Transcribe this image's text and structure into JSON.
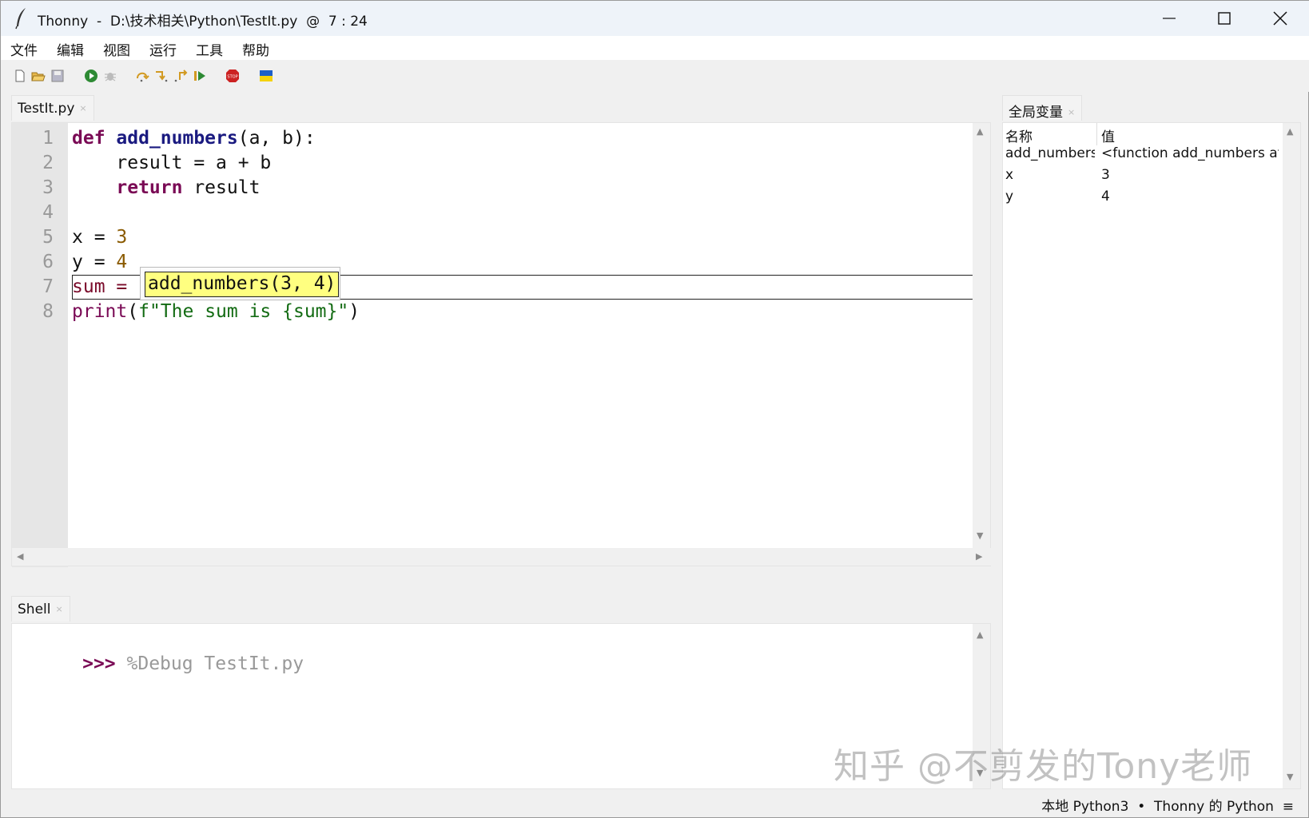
{
  "window": {
    "title": "Thonny  -  D:\\技术相关\\Python\\TestIt.py  @  7 : 24"
  },
  "menu": [
    "文件",
    "编辑",
    "视图",
    "运行",
    "工具",
    "帮助"
  ],
  "toolbar": {
    "icons": [
      "new-file-icon",
      "open-file-icon",
      "save-icon",
      "run-icon",
      "debug-icon",
      "step-over-icon",
      "step-into-icon",
      "step-out-icon",
      "resume-icon",
      "stop-icon",
      "ukraine-flag-icon"
    ]
  },
  "editor": {
    "tab_label": "TestIt.py",
    "tab_close": "×",
    "line_numbers": [
      "1",
      "2",
      "3",
      "4",
      "5",
      "6",
      "7",
      "8"
    ],
    "autocomplete": "add_numbers(3, 4)"
  },
  "shell": {
    "tab_label": "Shell",
    "tab_close": "×",
    "prompt": ">>>",
    "command": "%Debug TestIt.py"
  },
  "variables": {
    "tab_label": "全局变量",
    "tab_close": "×",
    "col_name": "名称",
    "col_value": "值",
    "rows": [
      {
        "name": "add_numbers",
        "value": "<function add_numbers at"
      },
      {
        "name": "x",
        "value": "3"
      },
      {
        "name": "y",
        "value": "4"
      }
    ]
  },
  "watermark": "知乎 @不剪发的Tony老师",
  "status": "本地 Python3  •  Thonny 的 Python  ≡"
}
